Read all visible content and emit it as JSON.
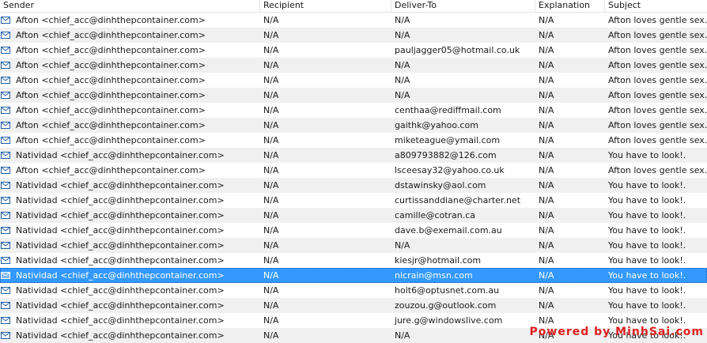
{
  "columns": {
    "sender": "Sender",
    "recipient": "Recipient",
    "deliver_to": "Deliver-To",
    "explanation": "Explanation",
    "subject": "Subject"
  },
  "colors": {
    "selection": "#3399ff",
    "alt_row": "#f0f0f0",
    "watermark": "#e02020"
  },
  "icon": "mail-envelope-icon",
  "rows": [
    {
      "sender": "Afton <chief_acc@dinhthepcontainer.com>",
      "recipient": "N/A",
      "deliver_to": "N/A",
      "explanation": "N/A",
      "subject": "Afton loves gentle sex."
    },
    {
      "sender": "Afton <chief_acc@dinhthepcontainer.com>",
      "recipient": "N/A",
      "deliver_to": "N/A",
      "explanation": "N/A",
      "subject": "Afton loves gentle sex."
    },
    {
      "sender": "Afton <chief_acc@dinhthepcontainer.com>",
      "recipient": "N/A",
      "deliver_to": "pauljagger05@hotmail.co.uk",
      "explanation": "N/A",
      "subject": "Afton loves gentle sex."
    },
    {
      "sender": "Afton <chief_acc@dinhthepcontainer.com>",
      "recipient": "N/A",
      "deliver_to": "N/A",
      "explanation": "N/A",
      "subject": "Afton loves gentle sex."
    },
    {
      "sender": "Afton <chief_acc@dinhthepcontainer.com>",
      "recipient": "N/A",
      "deliver_to": "N/A",
      "explanation": "N/A",
      "subject": "Afton loves gentle sex."
    },
    {
      "sender": "Afton <chief_acc@dinhthepcontainer.com>",
      "recipient": "N/A",
      "deliver_to": "N/A",
      "explanation": "N/A",
      "subject": "Afton loves gentle sex."
    },
    {
      "sender": "Afton <chief_acc@dinhthepcontainer.com>",
      "recipient": "N/A",
      "deliver_to": "centhaa@rediffmail.com",
      "explanation": "N/A",
      "subject": "Afton loves gentle sex."
    },
    {
      "sender": "Afton <chief_acc@dinhthepcontainer.com>",
      "recipient": "N/A",
      "deliver_to": "gaithk@yahoo.com",
      "explanation": "N/A",
      "subject": "Afton loves gentle sex."
    },
    {
      "sender": "Afton <chief_acc@dinhthepcontainer.com>",
      "recipient": "N/A",
      "deliver_to": "miketeague@ymail.com",
      "explanation": "N/A",
      "subject": "Afton loves gentle sex."
    },
    {
      "sender": "Natividad <chief_acc@dinhthepcontainer.com>",
      "recipient": "N/A",
      "deliver_to": "a809793882@126.com",
      "explanation": "N/A",
      "subject": "You have to look!."
    },
    {
      "sender": "Afton <chief_acc@dinhthepcontainer.com>",
      "recipient": "N/A",
      "deliver_to": "lsceesay32@yahoo.co.uk",
      "explanation": "N/A",
      "subject": "Afton loves gentle sex."
    },
    {
      "sender": "Natividad <chief_acc@dinhthepcontainer.com>",
      "recipient": "N/A",
      "deliver_to": "dstawinsky@aol.com",
      "explanation": "N/A",
      "subject": "You have to look!."
    },
    {
      "sender": "Natividad <chief_acc@dinhthepcontainer.com>",
      "recipient": "N/A",
      "deliver_to": "curtissanddiane@charter.net",
      "explanation": "N/A",
      "subject": "You have to look!."
    },
    {
      "sender": "Natividad <chief_acc@dinhthepcontainer.com>",
      "recipient": "N/A",
      "deliver_to": "camille@cotran.ca",
      "explanation": "N/A",
      "subject": "You have to look!."
    },
    {
      "sender": "Natividad <chief_acc@dinhthepcontainer.com>",
      "recipient": "N/A",
      "deliver_to": "dave.b@exemail.com.au",
      "explanation": "N/A",
      "subject": "You have to look!."
    },
    {
      "sender": "Natividad <chief_acc@dinhthepcontainer.com>",
      "recipient": "N/A",
      "deliver_to": "N/A",
      "explanation": "N/A",
      "subject": "You have to look!."
    },
    {
      "sender": "Natividad <chief_acc@dinhthepcontainer.com>",
      "recipient": "N/A",
      "deliver_to": "kiesjr@hotmail.com",
      "explanation": "N/A",
      "subject": "You have to look!."
    },
    {
      "sender": "Natividad <chief_acc@dinhthepcontainer.com>",
      "recipient": "N/A",
      "deliver_to": "nicrain@msn.com",
      "explanation": "N/A",
      "subject": "You have to look!.",
      "selected": true
    },
    {
      "sender": "Natividad <chief_acc@dinhthepcontainer.com>",
      "recipient": "N/A",
      "deliver_to": "holt6@optusnet.com.au",
      "explanation": "N/A",
      "subject": "You have to look!."
    },
    {
      "sender": "Natividad <chief_acc@dinhthepcontainer.com>",
      "recipient": "N/A",
      "deliver_to": "zouzou.g@outlook.com",
      "explanation": "N/A",
      "subject": "You have to look!."
    },
    {
      "sender": "Natividad <chief_acc@dinhthepcontainer.com>",
      "recipient": "N/A",
      "deliver_to": "jure.g@windowslive.com",
      "explanation": "N/A",
      "subject": "You have to look!."
    },
    {
      "sender": "Natividad <chief_acc@dinhthepcontainer.com>",
      "recipient": "N/A",
      "deliver_to": "N/A",
      "explanation": "N/A",
      "subject": "You have to look!."
    }
  ],
  "watermark": "Powered by MinhSai.com"
}
